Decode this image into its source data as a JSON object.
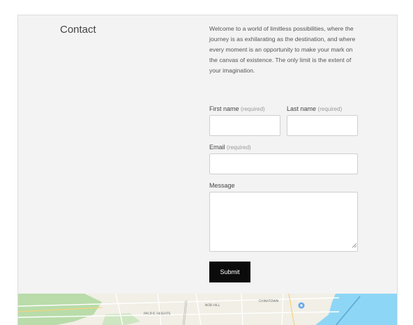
{
  "contact": {
    "heading": "Contact",
    "intro": "Welcome to a world of limitless possibilities, where the journey is as exhilarating as the destination, and where every moment is an opportunity to make your mark on the canvas of existence. The only limit is the extent of your imagination."
  },
  "form": {
    "first_name": {
      "label": "First name",
      "required": "(required)",
      "value": ""
    },
    "last_name": {
      "label": "Last name",
      "required": "(required)",
      "value": ""
    },
    "email": {
      "label": "Email",
      "required": "(required)",
      "value": ""
    },
    "message": {
      "label": "Message",
      "value": ""
    },
    "submit_label": "Submit"
  },
  "map": {
    "labels": [
      "PACIFIC HEIGHTS",
      "NOB HILL",
      "CHINATOWN"
    ],
    "colors": {
      "park": "#b9dcaa",
      "land": "#f1efe6",
      "water": "#8ed6f5",
      "road": "#ffffff"
    }
  }
}
